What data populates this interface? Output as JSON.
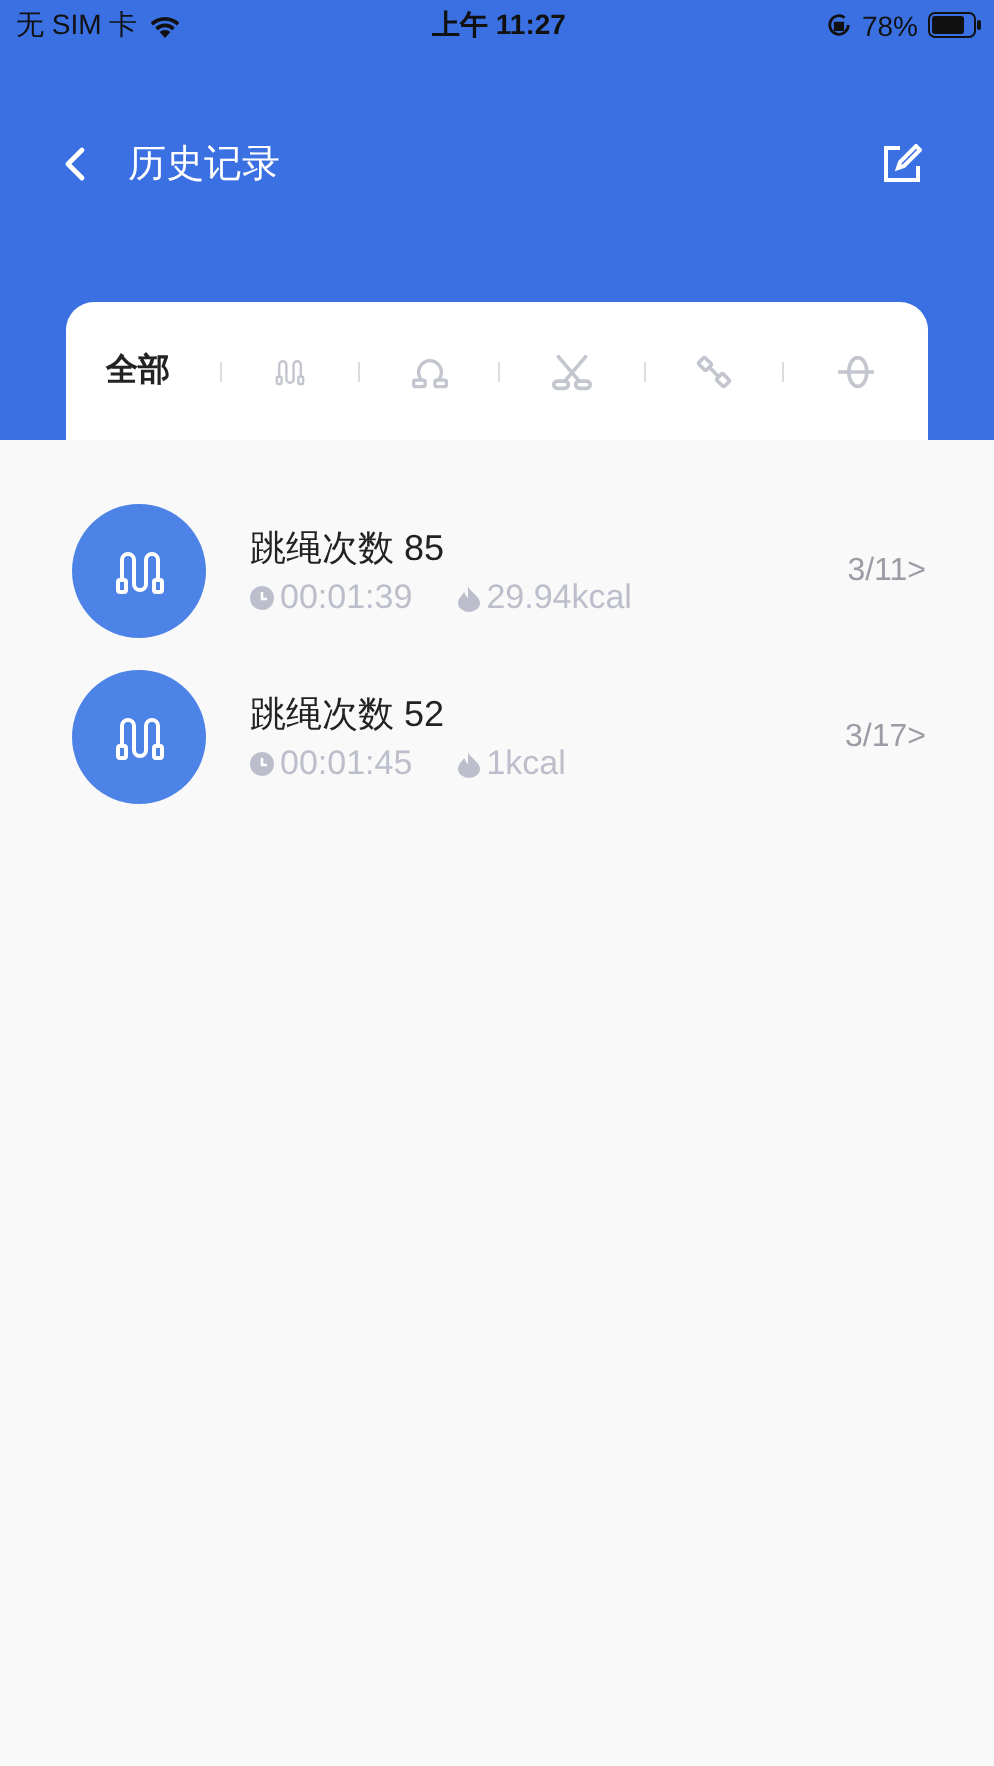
{
  "status_bar": {
    "carrier": "无 SIM 卡",
    "time": "上午 11:27",
    "battery": "78%"
  },
  "header": {
    "title": "历史记录"
  },
  "tabs": [
    {
      "kind": "text",
      "label": "全部",
      "selected": true
    },
    {
      "kind": "rope",
      "selected": false
    },
    {
      "kind": "ring",
      "selected": false
    },
    {
      "kind": "crossed",
      "selected": false
    },
    {
      "kind": "dumbbell",
      "selected": false
    },
    {
      "kind": "wheel",
      "selected": false
    }
  ],
  "records": [
    {
      "title": "跳绳次数 85",
      "duration": "00:01:39",
      "calories": "29.94kcal",
      "date": "3/11>"
    },
    {
      "title": "跳绳次数 52",
      "duration": "00:01:45",
      "calories": "1kcal",
      "date": "3/17>"
    }
  ]
}
